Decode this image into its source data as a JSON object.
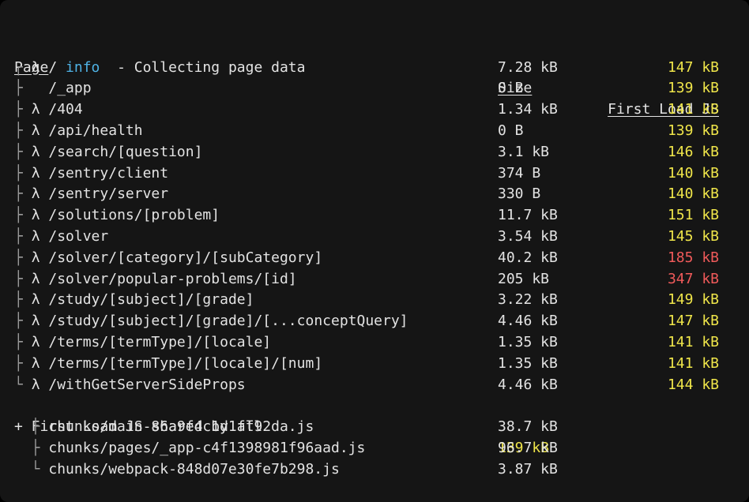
{
  "header": {
    "info_label": "info",
    "info_text": "  - Collecting page data"
  },
  "columns": {
    "page": "Page",
    "size": "Size",
    "first_load": "First Load JS"
  },
  "pages": [
    {
      "prefix": "┌ ",
      "symbol": "λ",
      "path": " /",
      "size": "7.28 kB",
      "first_load": "147 kB",
      "status": "yellow"
    },
    {
      "prefix": "├ ",
      "symbol": " ",
      "path": " /_app",
      "size": "0 B",
      "first_load": "139 kB",
      "status": "yellow"
    },
    {
      "prefix": "├ ",
      "symbol": "λ",
      "path": " /404",
      "size": "1.34 kB",
      "first_load": "141 kB",
      "status": "yellow"
    },
    {
      "prefix": "├ ",
      "symbol": "λ",
      "path": " /api/health",
      "size": "0 B",
      "first_load": "139 kB",
      "status": "yellow"
    },
    {
      "prefix": "├ ",
      "symbol": "λ",
      "path": " /search/[question]",
      "size": "3.1 kB",
      "first_load": "146 kB",
      "status": "yellow"
    },
    {
      "prefix": "├ ",
      "symbol": "λ",
      "path": " /sentry/client",
      "size": "374 B",
      "first_load": "140 kB",
      "status": "yellow"
    },
    {
      "prefix": "├ ",
      "symbol": "λ",
      "path": " /sentry/server",
      "size": "330 B",
      "first_load": "140 kB",
      "status": "yellow"
    },
    {
      "prefix": "├ ",
      "symbol": "λ",
      "path": " /solutions/[problem]",
      "size": "11.7 kB",
      "first_load": "151 kB",
      "status": "yellow"
    },
    {
      "prefix": "├ ",
      "symbol": "λ",
      "path": " /solver",
      "size": "3.54 kB",
      "first_load": "145 kB",
      "status": "yellow"
    },
    {
      "prefix": "├ ",
      "symbol": "λ",
      "path": " /solver/[category]/[subCategory]",
      "size": "40.2 kB",
      "first_load": "185 kB",
      "status": "red"
    },
    {
      "prefix": "├ ",
      "symbol": "λ",
      "path": " /solver/popular-problems/[id]",
      "size": "205 kB",
      "first_load": "347 kB",
      "status": "red"
    },
    {
      "prefix": "├ ",
      "symbol": "λ",
      "path": " /study/[subject]/[grade]",
      "size": "3.22 kB",
      "first_load": "149 kB",
      "status": "yellow"
    },
    {
      "prefix": "├ ",
      "symbol": "λ",
      "path": " /study/[subject]/[grade]/[...conceptQuery]",
      "size": "4.46 kB",
      "first_load": "147 kB",
      "status": "yellow"
    },
    {
      "prefix": "├ ",
      "symbol": "λ",
      "path": " /terms/[termType]/[locale]",
      "size": "1.35 kB",
      "first_load": "141 kB",
      "status": "yellow"
    },
    {
      "prefix": "├ ",
      "symbol": "λ",
      "path": " /terms/[termType]/[locale]/[num]",
      "size": "1.35 kB",
      "first_load": "141 kB",
      "status": "yellow"
    },
    {
      "prefix": "└ ",
      "symbol": "λ",
      "path": " /withGetServerSideProps",
      "size": "4.46 kB",
      "first_load": "144 kB",
      "status": "yellow"
    }
  ],
  "shared": {
    "label": "+ First Load JS shared by all",
    "value": "139 kB",
    "chunks": [
      {
        "prefix": "  ├ ",
        "name": "chunks/main-86a9f4c1d1ff92da.js",
        "size": "38.7 kB"
      },
      {
        "prefix": "  ├ ",
        "name": "chunks/pages/_app-c4f1398981f96aad.js",
        "size": "96.7 kB"
      },
      {
        "prefix": "  └ ",
        "name": "chunks/webpack-848d07e30fe7b298.js",
        "size": "3.87 kB"
      }
    ]
  },
  "colors": {
    "background": "#151515",
    "text": "#e3e3e3",
    "info": "#4fb3e6",
    "ok": "#f0e64a",
    "warn": "#f05a5a"
  }
}
